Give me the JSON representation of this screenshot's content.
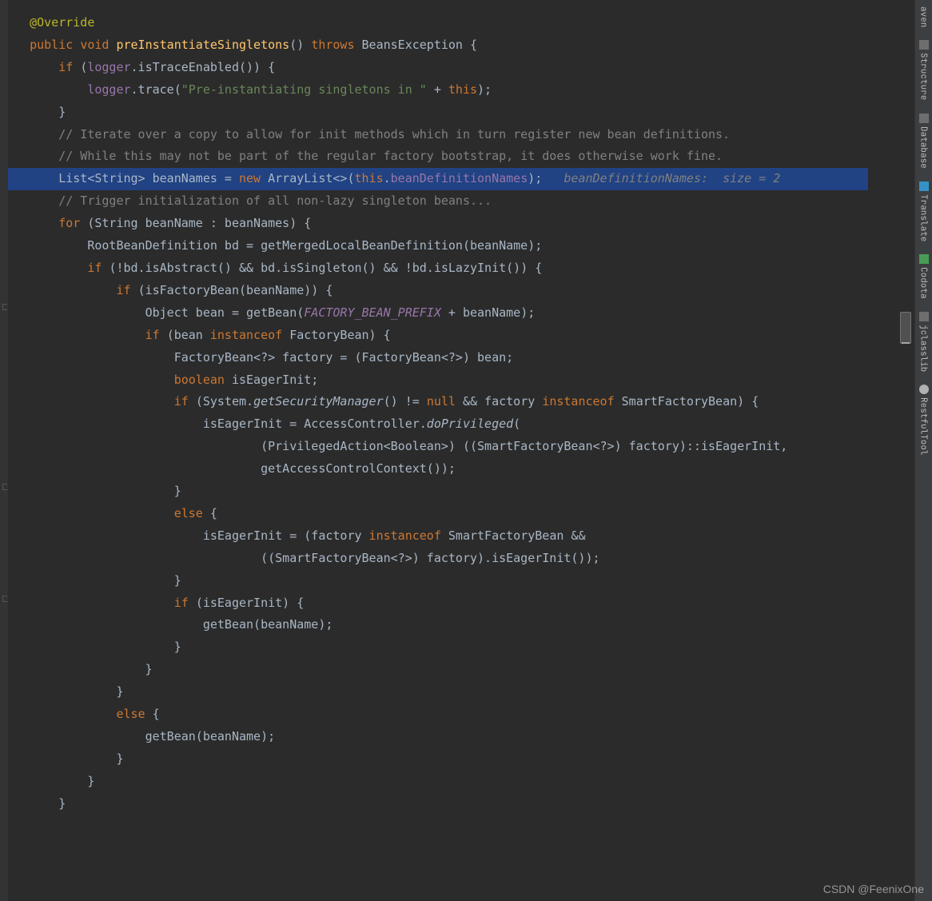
{
  "code": {
    "l1_ann": "@Override",
    "l2_1": "public ",
    "l2_2": "void ",
    "l2_3": "preInstantiateSingletons",
    "l2_4": "() ",
    "l2_5": "throws ",
    "l2_6": "BeansException {",
    "l3_1": "    if ",
    "l3_2": "(",
    "l3_3": "logger",
    "l3_4": ".isTraceEnabled()) {",
    "l4_1": "        logger",
    "l4_2": ".trace(",
    "l4_3": "\"Pre-instantiating singletons in \" ",
    "l4_4": "+ ",
    "l4_5": "this",
    "l4_6": ");",
    "l5": "    }",
    "l6": "",
    "l7": "    // Iterate over a copy to allow for init methods which in turn register new bean definitions.",
    "l8": "    // While this may not be part of the regular factory bootstrap, it does otherwise work fine.",
    "l9_1": "    List<String> beanNames = ",
    "l9_2": "new ",
    "l9_3": "ArrayList<>(",
    "l9_4": "this",
    "l9_5": ".",
    "l9_6": "beanDefinitionNames",
    "l9_7": ");   ",
    "l9_inlay": "beanDefinitionNames:  size = 2",
    "l10": "",
    "l11": "    // Trigger initialization of all non-lazy singleton beans...",
    "l12_1": "    for ",
    "l12_2": "(String beanName : beanNames) {",
    "l13": "        RootBeanDefinition bd = getMergedLocalBeanDefinition(beanName);",
    "l14_1": "        if ",
    "l14_2": "(!bd.isAbstract() && bd.isSingleton() && !bd.isLazyInit()) {",
    "l15_1": "            if ",
    "l15_2": "(isFactoryBean(beanName)) {",
    "l16_1": "                Object bean = getBean(",
    "l16_2": "FACTORY_BEAN_PREFIX ",
    "l16_3": "+ beanName);",
    "l17_1": "                if ",
    "l17_2": "(bean ",
    "l17_3": "instanceof ",
    "l17_4": "FactoryBean) {",
    "l18": "                    FactoryBean<?> factory = (FactoryBean<?>) bean;",
    "l19_1": "                    boolean ",
    "l19_2": "isEagerInit;",
    "l20_1": "                    if ",
    "l20_2": "(System.",
    "l20_3": "getSecurityManager",
    "l20_4": "() != ",
    "l20_5": "null ",
    "l20_6": "&& factory ",
    "l20_7": "instanceof ",
    "l20_8": "SmartFactoryBean) {",
    "l21_1": "                        isEagerInit = AccessController.",
    "l21_2": "doPrivileged",
    "l21_3": "(",
    "l22": "                                (PrivilegedAction<Boolean>) ((SmartFactoryBean<?>) factory)::isEagerInit,",
    "l23": "                                getAccessControlContext());",
    "l24": "                    }",
    "l25_1": "                    else ",
    "l25_2": "{",
    "l26_1": "                        isEagerInit = (factory ",
    "l26_2": "instanceof ",
    "l26_3": "SmartFactoryBean &&",
    "l27": "                                ((SmartFactoryBean<?>) factory).isEagerInit());",
    "l28": "                    }",
    "l29_1": "                    if ",
    "l29_2": "(isEagerInit) {",
    "l30": "                        getBean(beanName);",
    "l31": "                    }",
    "l32": "                }",
    "l33": "            }",
    "l34_1": "            else ",
    "l34_2": "{",
    "l35": "                getBean(beanName);",
    "l36": "            }",
    "l37": "        }",
    "l38": "    }"
  },
  "sidebar": {
    "aven": "aven",
    "structure": "Structure",
    "database": "Database",
    "translate": "Translate",
    "codota": "Codota",
    "jclasslib": "jclasslib",
    "restful": "RestfulTool"
  },
  "watermark": "CSDN @FeenixOne"
}
